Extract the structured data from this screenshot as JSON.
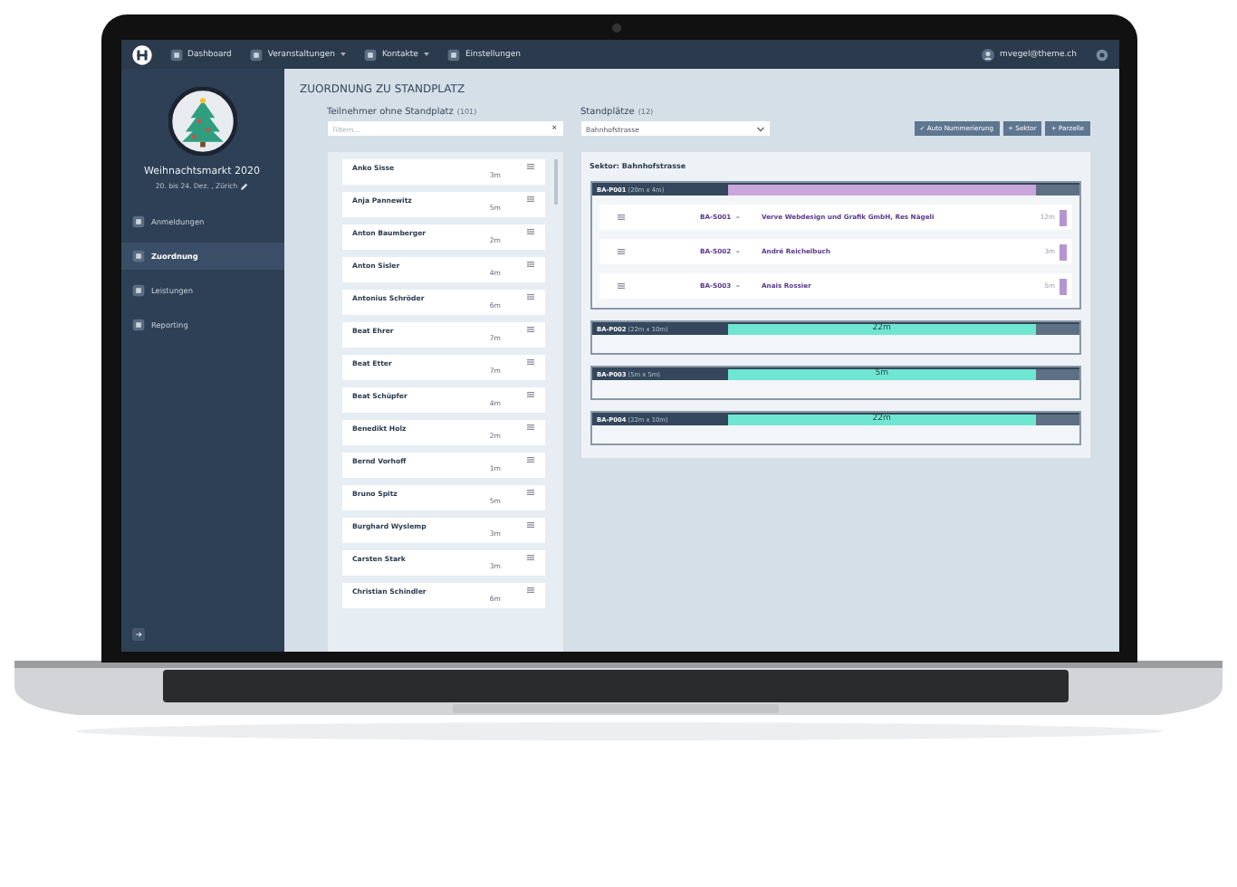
{
  "nav": {
    "items": [
      {
        "label": "Dashboard",
        "dropdown": false
      },
      {
        "label": "Veranstaltungen",
        "dropdown": true
      },
      {
        "label": "Kontakte",
        "dropdown": true
      },
      {
        "label": "Einstellungen",
        "dropdown": false
      }
    ],
    "user": "mvegel@theme.ch"
  },
  "sidebar": {
    "event_title": "Weihnachtsmarkt 2020",
    "event_subtitle": "20. bis 24. Dez. , Zürich",
    "items": [
      {
        "label": "Anmeldungen",
        "selected": false
      },
      {
        "label": "Zuordnung",
        "selected": true
      },
      {
        "label": "Leistungen",
        "selected": false
      },
      {
        "label": "Reporting",
        "selected": false
      }
    ]
  },
  "page_title": "ZUORDNUNG ZU STANDPLATZ",
  "participants": {
    "label": "Teilnehmer ohne Standplatz",
    "count": "(101)",
    "filter": {
      "placeholder": "Filtern...",
      "clear": "×"
    },
    "rows": [
      {
        "name": "Anko Sisse",
        "size": "3m"
      },
      {
        "name": "Anja Pannewitz",
        "size": "5m"
      },
      {
        "name": "Anton Baumberger",
        "size": "2m"
      },
      {
        "name": "Anton Sisler",
        "size": "4m"
      },
      {
        "name": "Antonius Schröder",
        "size": "6m"
      },
      {
        "name": "Beat Ehrer",
        "size": "7m"
      },
      {
        "name": "Beat Etter",
        "size": "7m"
      },
      {
        "name": "Beat Schüpfer",
        "size": "4m"
      },
      {
        "name": "Benedikt Holz",
        "size": "2m"
      },
      {
        "name": "Bernd Vorhoff",
        "size": "1m"
      },
      {
        "name": "Bruno Spitz",
        "size": "5m"
      },
      {
        "name": "Burghard Wyslemp",
        "size": "3m"
      },
      {
        "name": "Carsten Stark",
        "size": "3m"
      },
      {
        "name": "Christian Schindler",
        "size": "6m"
      }
    ]
  },
  "places": {
    "label": "Standplätze",
    "count": "(12)",
    "select": "Bahnhofstrasse",
    "buttons": [
      {
        "label": "✓ Auto Nummerierung"
      },
      {
        "label": "+ Sektor"
      },
      {
        "label": "+ Parzelle"
      }
    ],
    "sector": "Sektor: Bahnhofstrasse",
    "parcels": [
      {
        "code": "BA-P001",
        "dims": "(20m x 4m)",
        "color": "#c9a6dc",
        "level": 0.88,
        "stands": [
          {
            "code": "BA-S001",
            "dash": "–",
            "name": "Verve Webdesign und Grafik GmbH, Res Nägeli",
            "size": "12m"
          },
          {
            "code": "BA-S002",
            "dash": "–",
            "name": "André Reichelbuch",
            "size": "3m"
          },
          {
            "code": "BA-S003",
            "dash": "–",
            "name": "Anais Rossier",
            "size": "5m"
          }
        ]
      },
      {
        "code": "BA-P002",
        "dims": "(22m x 10m)",
        "color": "#6fe6d2",
        "level": 0.88,
        "bar_label": "22m"
      },
      {
        "code": "BA-P003",
        "dims": "(5m x 5m)",
        "color": "#6fe6d2",
        "level": 0.88,
        "bar_label": "5m"
      },
      {
        "code": "BA-P004",
        "dims": "(22m x 10m)",
        "color": "#6fe6d2",
        "level": 0.88,
        "bar_label": "22m"
      }
    ]
  }
}
